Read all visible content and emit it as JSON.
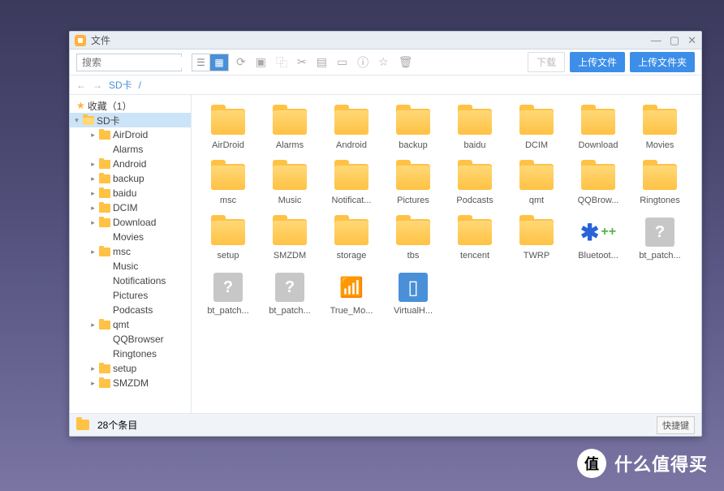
{
  "window": {
    "title": "文件"
  },
  "search": {
    "placeholder": "搜索"
  },
  "toolbar": {
    "download": "下载",
    "upload_file": "上传文件",
    "upload_folder": "上传文件夹"
  },
  "breadcrumb": {
    "root": "SD卡",
    "sep": "/"
  },
  "sidebar": {
    "favorites": "收藏（1）",
    "root": "SD卡",
    "items": [
      {
        "label": "AirDroid",
        "depth": 2,
        "hasFolder": true,
        "exp": "▸"
      },
      {
        "label": "Alarms",
        "depth": 2,
        "hasFolder": false
      },
      {
        "label": "Android",
        "depth": 2,
        "hasFolder": true,
        "exp": "▸"
      },
      {
        "label": "backup",
        "depth": 2,
        "hasFolder": true,
        "exp": "▸"
      },
      {
        "label": "baidu",
        "depth": 2,
        "hasFolder": true,
        "exp": "▸"
      },
      {
        "label": "DCIM",
        "depth": 2,
        "hasFolder": true,
        "exp": "▸"
      },
      {
        "label": "Download",
        "depth": 2,
        "hasFolder": true,
        "exp": "▸"
      },
      {
        "label": "Movies",
        "depth": 2,
        "hasFolder": false
      },
      {
        "label": "msc",
        "depth": 2,
        "hasFolder": true,
        "exp": "▸"
      },
      {
        "label": "Music",
        "depth": 2,
        "hasFolder": false
      },
      {
        "label": "Notifications",
        "depth": 2,
        "hasFolder": false
      },
      {
        "label": "Pictures",
        "depth": 2,
        "hasFolder": false
      },
      {
        "label": "Podcasts",
        "depth": 2,
        "hasFolder": false
      },
      {
        "label": "qmt",
        "depth": 2,
        "hasFolder": true,
        "exp": "▸"
      },
      {
        "label": "QQBrowser",
        "depth": 2,
        "hasFolder": false
      },
      {
        "label": "Ringtones",
        "depth": 2,
        "hasFolder": false
      },
      {
        "label": "setup",
        "depth": 2,
        "hasFolder": true,
        "exp": "▸"
      },
      {
        "label": "SMZDM",
        "depth": 2,
        "hasFolder": true,
        "exp": "▸"
      }
    ]
  },
  "files": [
    {
      "name": "AirDroid",
      "type": "folder"
    },
    {
      "name": "Alarms",
      "type": "folder"
    },
    {
      "name": "Android",
      "type": "folder"
    },
    {
      "name": "backup",
      "type": "folder"
    },
    {
      "name": "baidu",
      "type": "folder"
    },
    {
      "name": "DCIM",
      "type": "folder"
    },
    {
      "name": "Download",
      "type": "folder"
    },
    {
      "name": "Movies",
      "type": "folder"
    },
    {
      "name": "msc",
      "type": "folder"
    },
    {
      "name": "Music",
      "type": "folder"
    },
    {
      "name": "Notificat...",
      "type": "folder"
    },
    {
      "name": "Pictures",
      "type": "folder"
    },
    {
      "name": "Podcasts",
      "type": "folder"
    },
    {
      "name": "qmt",
      "type": "folder"
    },
    {
      "name": "QQBrow...",
      "type": "folder"
    },
    {
      "name": "Ringtones",
      "type": "folder"
    },
    {
      "name": "setup",
      "type": "folder"
    },
    {
      "name": "SMZDM",
      "type": "folder"
    },
    {
      "name": "storage",
      "type": "folder"
    },
    {
      "name": "tbs",
      "type": "folder"
    },
    {
      "name": "tencent",
      "type": "folder"
    },
    {
      "name": "TWRP",
      "type": "folder"
    },
    {
      "name": "Bluetoot...",
      "type": "bt"
    },
    {
      "name": "bt_patch...",
      "type": "unknown"
    },
    {
      "name": "bt_patch...",
      "type": "unknown"
    },
    {
      "name": "bt_patch...",
      "type": "unknown"
    },
    {
      "name": "True_Mo...",
      "type": "img1"
    },
    {
      "name": "VirtualH...",
      "type": "img2"
    }
  ],
  "status": {
    "count": "28个条目",
    "hotkey": "快捷键"
  },
  "watermark": {
    "badge": "值",
    "text": "什么值得买"
  }
}
